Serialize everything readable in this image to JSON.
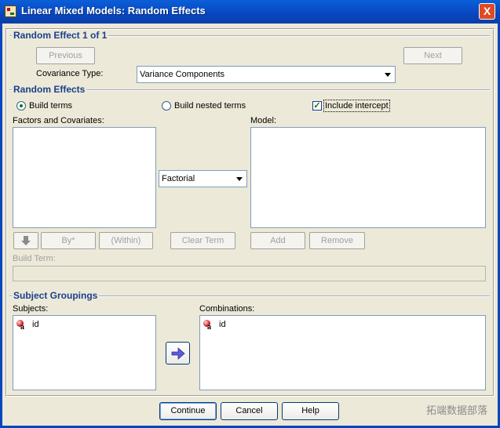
{
  "window": {
    "title": "Linear Mixed Models: Random Effects",
    "close": "X"
  },
  "random_effect_header": "Random Effect 1 of 1",
  "nav": {
    "previous": "Previous",
    "next": "Next"
  },
  "covariance": {
    "label": "Covariance Type:",
    "value": "Variance Components"
  },
  "random_effects": {
    "header": "Random Effects",
    "build_terms": "Build terms",
    "build_nested_terms": "Build nested terms",
    "include_intercept": "Include intercept",
    "include_intercept_checked": true,
    "build_terms_selected": true
  },
  "factors_label": "Factors and Covariates:",
  "model_label": "Model:",
  "factorial_select": "Factorial",
  "term_buttons": {
    "by": "By*",
    "within": "(Within)",
    "clear_term": "Clear Term",
    "add": "Add",
    "remove": "Remove"
  },
  "build_term_label": "Build Term:",
  "subject_groupings": {
    "header": "Subject Groupings",
    "subjects_label": "Subjects:",
    "combinations_label": "Combinations:",
    "subjects": [
      "id"
    ],
    "combinations": [
      "id"
    ]
  },
  "footer": {
    "continue": "Continue",
    "cancel": "Cancel",
    "help": "Help"
  },
  "watermark": "拓端数据部落"
}
